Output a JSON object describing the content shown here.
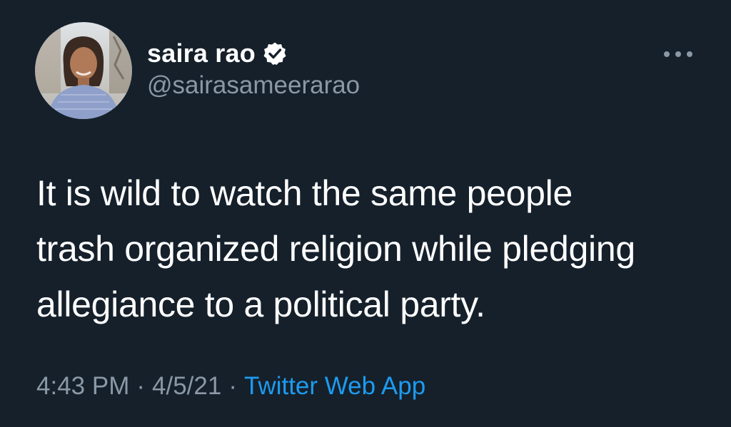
{
  "tweet": {
    "author": {
      "display_name": "saira rao",
      "handle": "@sairasameerarao",
      "verified_icon": "verified-badge-icon",
      "avatar": "profile-photo"
    },
    "more_icon": "more-options-icon",
    "text": "It is wild to watch the same people\ntrash organized religion while pledging\nallegiance to a political party.",
    "meta": {
      "time": "4:43 PM",
      "separator": "·",
      "date": "4/5/21",
      "source": "Twitter Web App"
    }
  },
  "colors": {
    "background": "#15202b",
    "primary_text": "#ffffff",
    "secondary_text": "#8b98a5",
    "link": "#1d9bf0"
  }
}
